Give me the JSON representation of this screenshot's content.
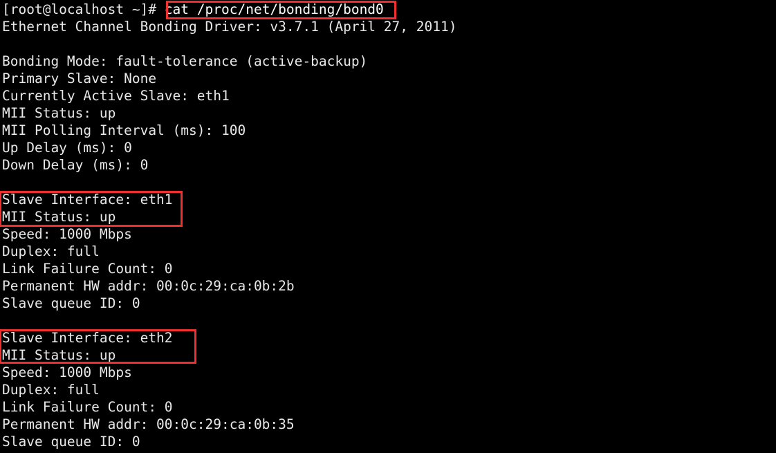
{
  "terminal": {
    "background_color": "#000000",
    "text_color": "#e8e8e8",
    "highlight_color": "#f0302f",
    "prompt": "[root@localhost ~]#",
    "command": "cat /proc/net/bonding/bond0",
    "prompt_line": "[root@localhost ~]# cat /proc/net/bonding/bond0"
  },
  "output": {
    "driver_line": "Ethernet Channel Bonding Driver: v3.7.1 (April 27, 2011)",
    "blank": "",
    "bonding": [
      "Bonding Mode: fault-tolerance (active-backup)",
      "Primary Slave: None",
      "Currently Active Slave: eth1",
      "MII Status: up",
      "MII Polling Interval (ms): 100",
      "Up Delay (ms): 0",
      "Down Delay (ms): 0"
    ],
    "slave1": {
      "interface": "Slave Interface: eth1",
      "mii_status": "MII Status: up",
      "speed": "Speed: 1000 Mbps",
      "duplex": "Duplex: full",
      "link_failure_count": "Link Failure Count: 0",
      "permanent_hw_addr": "Permanent HW addr: 00:0c:29:ca:0b:2b",
      "slave_queue_id": "Slave queue ID: 0"
    },
    "slave2": {
      "interface": "Slave Interface: eth2",
      "mii_status": "MII Status: up",
      "speed": "Speed: 1000 Mbps",
      "duplex": "Duplex: full",
      "link_failure_count": "Link Failure Count: 0",
      "permanent_hw_addr": "Permanent HW addr: 00:0c:29:ca:0b:35",
      "slave_queue_id": "Slave queue ID: 0"
    }
  },
  "annotations": {
    "command_box_label": "cat /proc/net/bonding/bond0",
    "slave1_box_label": "Slave Interface: eth1 / MII Status: up",
    "slave2_box_label": "Slave Interface: eth2 / MII Status: up"
  }
}
